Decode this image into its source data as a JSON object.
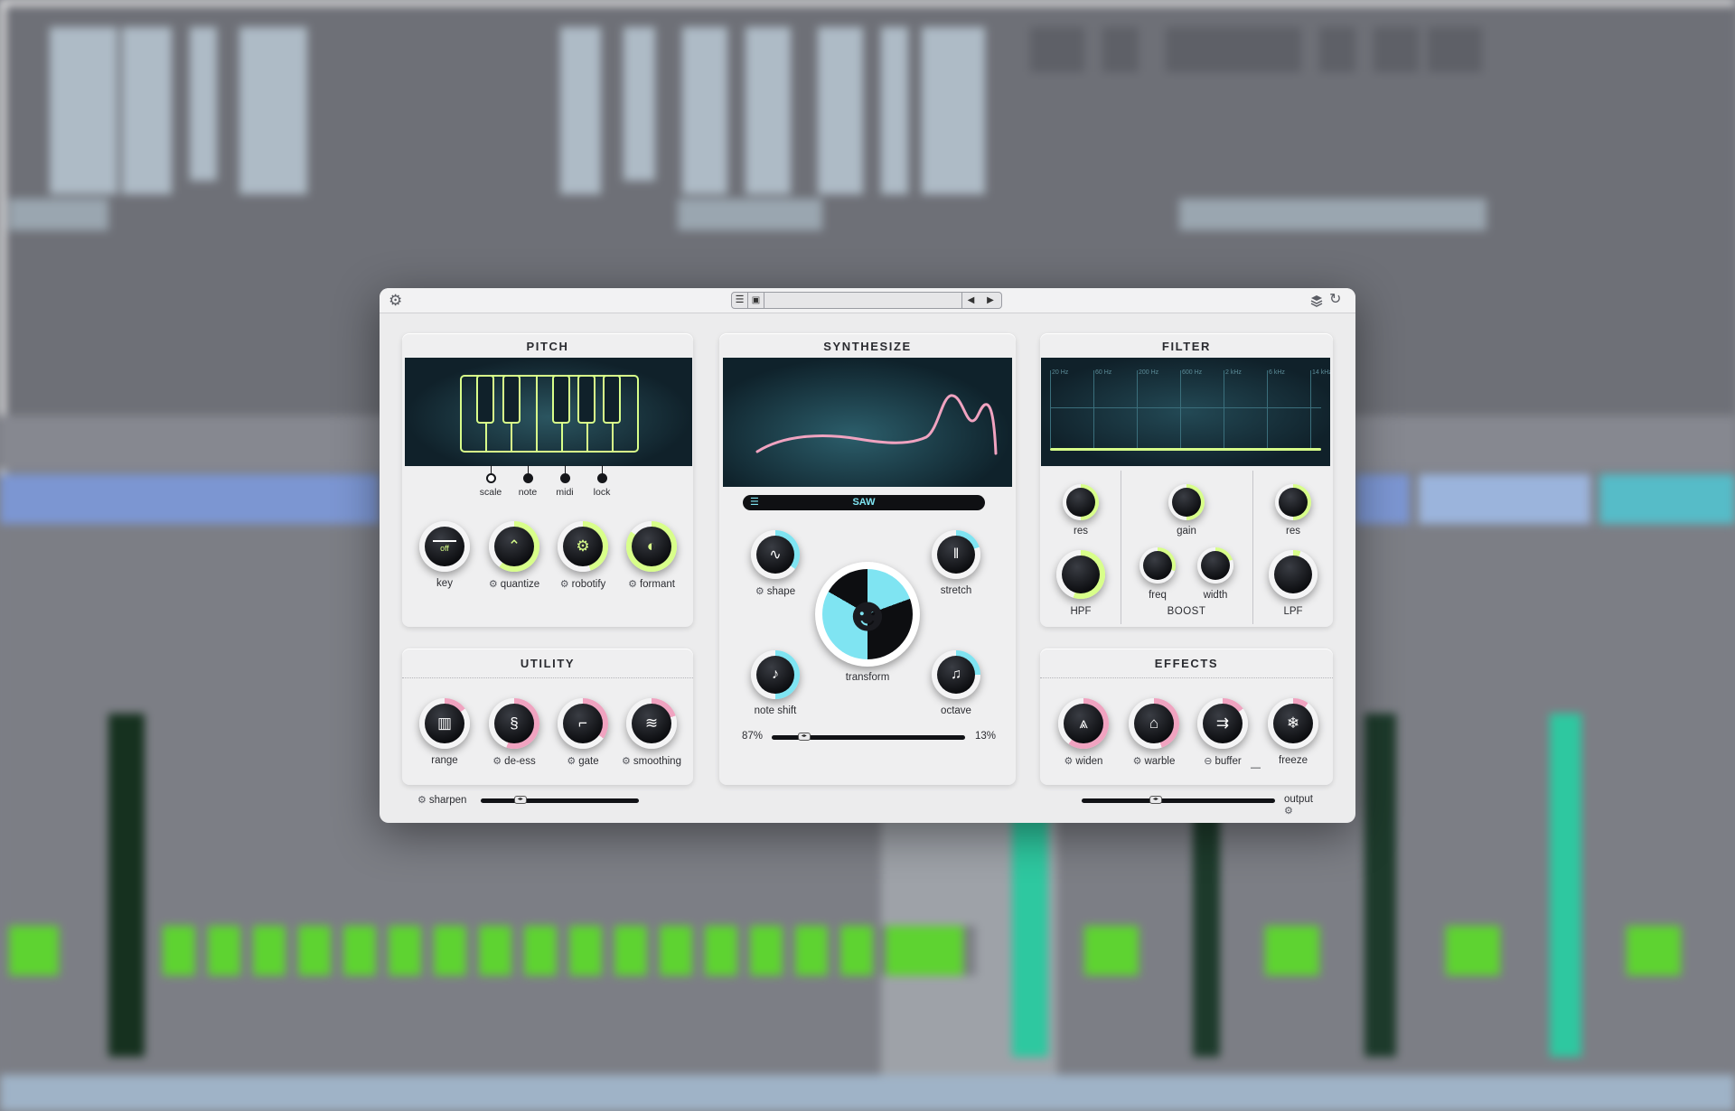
{
  "colors": {
    "accent_green": "#d8ff8a",
    "accent_cyan": "#7fe4f2",
    "accent_pink": "#f0a3c0",
    "knob_face": "#0d0e11",
    "panel_bg": "#efeff0",
    "screen_bg": "#17303a"
  },
  "toolbar": {
    "settings_icon": "gear-icon",
    "menu_icon": "hamburger-icon",
    "save_icon": "floppy-icon",
    "prev_icon": "triangle-left-icon",
    "next_icon": "triangle-right-icon",
    "layers_icon": "layers-icon",
    "reset_icon": "refresh-icon",
    "preset_name": ""
  },
  "pitch": {
    "title": "PITCH",
    "modes": [
      {
        "label": "scale",
        "selected": true
      },
      {
        "label": "note",
        "selected": false
      },
      {
        "label": "midi",
        "selected": false
      },
      {
        "label": "lock",
        "selected": false
      }
    ],
    "knobs": [
      {
        "label": "key",
        "display": "off",
        "has_gear": false
      },
      {
        "label": "quantize",
        "has_gear": true,
        "icon": "peak-icon",
        "value": 0.6
      },
      {
        "label": "robotify",
        "has_gear": true,
        "icon": "robot-head-icon",
        "value": 0.45
      },
      {
        "label": "formant",
        "has_gear": true,
        "icon": "half-circle-icon",
        "value": 0.85
      }
    ]
  },
  "utility": {
    "title": "UTILITY",
    "knobs": [
      {
        "label": "range",
        "has_gear": false,
        "icon": "piano-keys-icon",
        "value": 0.15
      },
      {
        "label": "de-ess",
        "has_gear": true,
        "icon": "s-curve-icon",
        "value": 0.55
      },
      {
        "label": "gate",
        "has_gear": true,
        "icon": "gate-icon",
        "value": 0.35
      },
      {
        "label": "smoothing",
        "has_gear": true,
        "icon": "wave-icon",
        "value": 0.2
      }
    ],
    "sharpen": {
      "label": "sharpen",
      "value": 0.25
    }
  },
  "synthesize": {
    "title": "SYNTHESIZE",
    "waveform": "SAW",
    "knobs": {
      "shape": {
        "label": "shape",
        "has_gear": true,
        "icon": "sine-icon",
        "value": 0.35
      },
      "stretch": {
        "label": "stretch",
        "icon": "bars-icon",
        "value": 0.2
      },
      "note_shift": {
        "label": "note shift",
        "icon": "music-note-icon",
        "value": 0.5
      },
      "octave": {
        "label": "octave",
        "icon": "double-note-icon",
        "value": 0.25
      },
      "transform": {
        "label": "transform",
        "icon": "face-icon"
      }
    },
    "mix": {
      "left": "87%",
      "right": "13%",
      "value": 0.13
    }
  },
  "filter": {
    "title": "FILTER",
    "freq_labels": [
      "20 Hz",
      "60 Hz",
      "200 Hz",
      "600 Hz",
      "2 kHz",
      "6 kHz",
      "14 kHz"
    ],
    "knobs": {
      "res_left": {
        "label": "res",
        "value": 0.5
      },
      "hpf": {
        "label": "HPF",
        "value": 0.55
      },
      "gain": {
        "label": "gain",
        "value": 0.5
      },
      "freq": {
        "label": "freq",
        "value": 0.3
      },
      "width": {
        "label": "width",
        "value": 0.2
      },
      "boost": {
        "label": "BOOST"
      },
      "res_right": {
        "label": "res",
        "value": 0.5
      },
      "lpf": {
        "label": "LPF",
        "value": 0.05
      }
    }
  },
  "effects": {
    "title": "EFFECTS",
    "knobs": [
      {
        "label": "widen",
        "has_gear": true,
        "icon": "mountains-icon",
        "value": 0.6
      },
      {
        "label": "warble",
        "has_gear": true,
        "icon": "ghost-icon",
        "value": 0.45
      },
      {
        "label": "buffer",
        "has_link": true,
        "icon": "buffer-icon",
        "value": 0.15
      },
      {
        "label": "freeze",
        "has_gear": false,
        "icon": "snowflake-icon",
        "value": 0.1
      }
    ],
    "link_dash": "—",
    "output": {
      "label": "output",
      "value": 0.35
    }
  }
}
